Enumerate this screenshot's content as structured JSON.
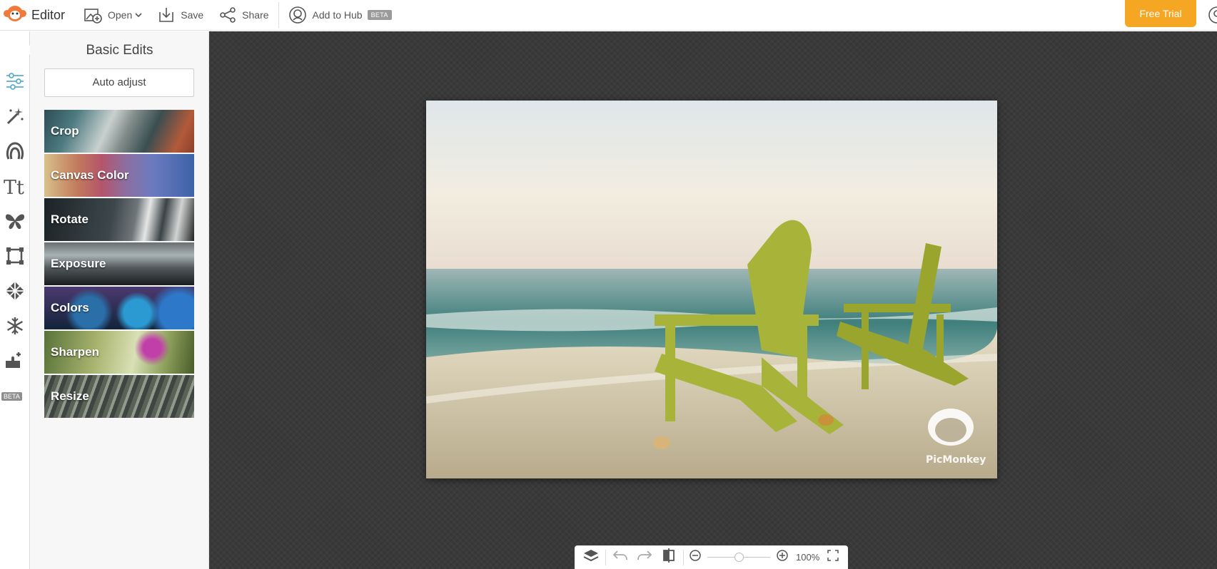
{
  "app": {
    "title": "Editor",
    "logo_icon": "monkey-logo-icon",
    "accent": "#f5a623"
  },
  "toolbar": {
    "open_label": "Open",
    "save_label": "Save",
    "share_label": "Share",
    "hub_label": "Add to Hub",
    "hub_badge": "BETA",
    "free_trial_label": "Free Trial"
  },
  "rail": {
    "items": [
      {
        "icon": "sliders-icon",
        "active": true
      },
      {
        "icon": "magic-wand-icon"
      },
      {
        "icon": "face-outline-icon"
      },
      {
        "icon": "text-tt-icon"
      },
      {
        "icon": "butterfly-icon"
      },
      {
        "icon": "frame-icon"
      },
      {
        "icon": "texture-icon"
      },
      {
        "icon": "snowflake-icon"
      },
      {
        "icon": "puzzle-icon",
        "badge": "BETA"
      }
    ]
  },
  "panel": {
    "title": "Basic Edits",
    "auto_adjust_label": "Auto adjust",
    "tiles": [
      {
        "label": "Crop"
      },
      {
        "label": "Canvas Color"
      },
      {
        "label": "Rotate"
      },
      {
        "label": "Exposure"
      },
      {
        "label": "Colors"
      },
      {
        "label": "Sharpen"
      },
      {
        "label": "Resize"
      }
    ]
  },
  "canvas": {
    "photo_description_icon": "beach-chairs-photo",
    "watermark_text": "PicMonkey"
  },
  "bottom_toolbar": {
    "zoom_value": "100%",
    "zoom_fraction": 0.5
  }
}
